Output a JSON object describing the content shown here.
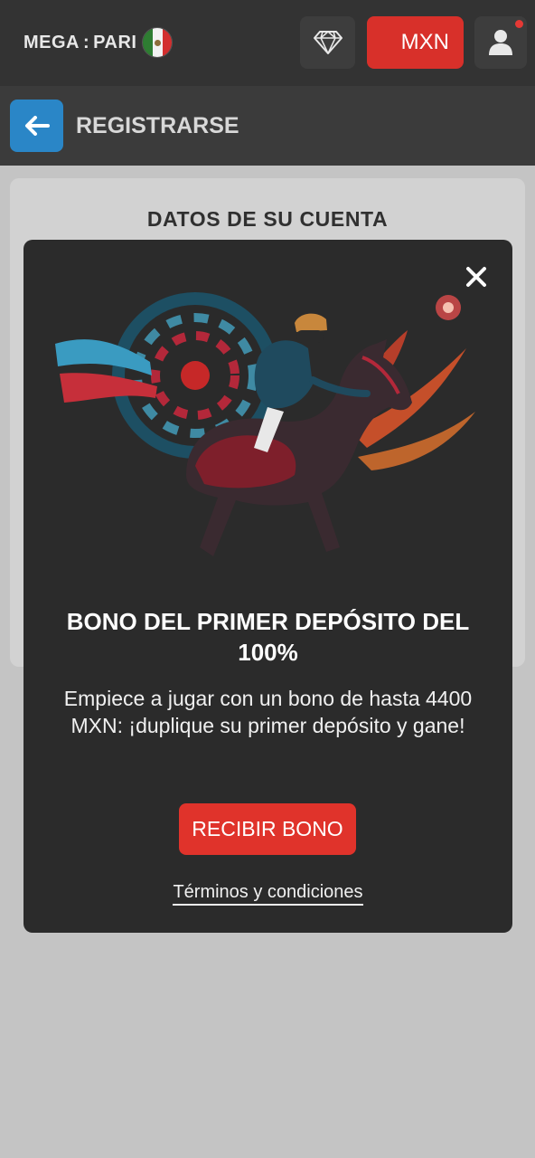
{
  "header": {
    "logo_left": "MEGA",
    "logo_sep": ":",
    "logo_right": "PARI",
    "flag": "mexico-flag",
    "diamond_icon": "diamond-icon",
    "currency_label": "MXN",
    "user_icon": "user-icon",
    "notification": true
  },
  "subheader": {
    "back_icon": "arrow-left-icon",
    "title": "REGISTRARSE"
  },
  "card": {
    "title": "DATOS DE SU CUENTA"
  },
  "modal": {
    "close_icon": "close-icon",
    "image": "horse-racing-jockey-illustration",
    "title": "BONO DEL PRIMER DEPÓSITO DEL 100%",
    "description": "Empiece a jugar con un bono de hasta 4400 MXN: ¡duplique su primer depósito y gane!",
    "cta_label": "RECIBIR BONO",
    "terms_label": "Términos y condiciones"
  },
  "colors": {
    "header_bg": "#333333",
    "accent_red": "#e0332b",
    "back_blue": "#2a86c7",
    "modal_bg": "#2b2b2b",
    "page_bg": "#c4c4c4"
  }
}
